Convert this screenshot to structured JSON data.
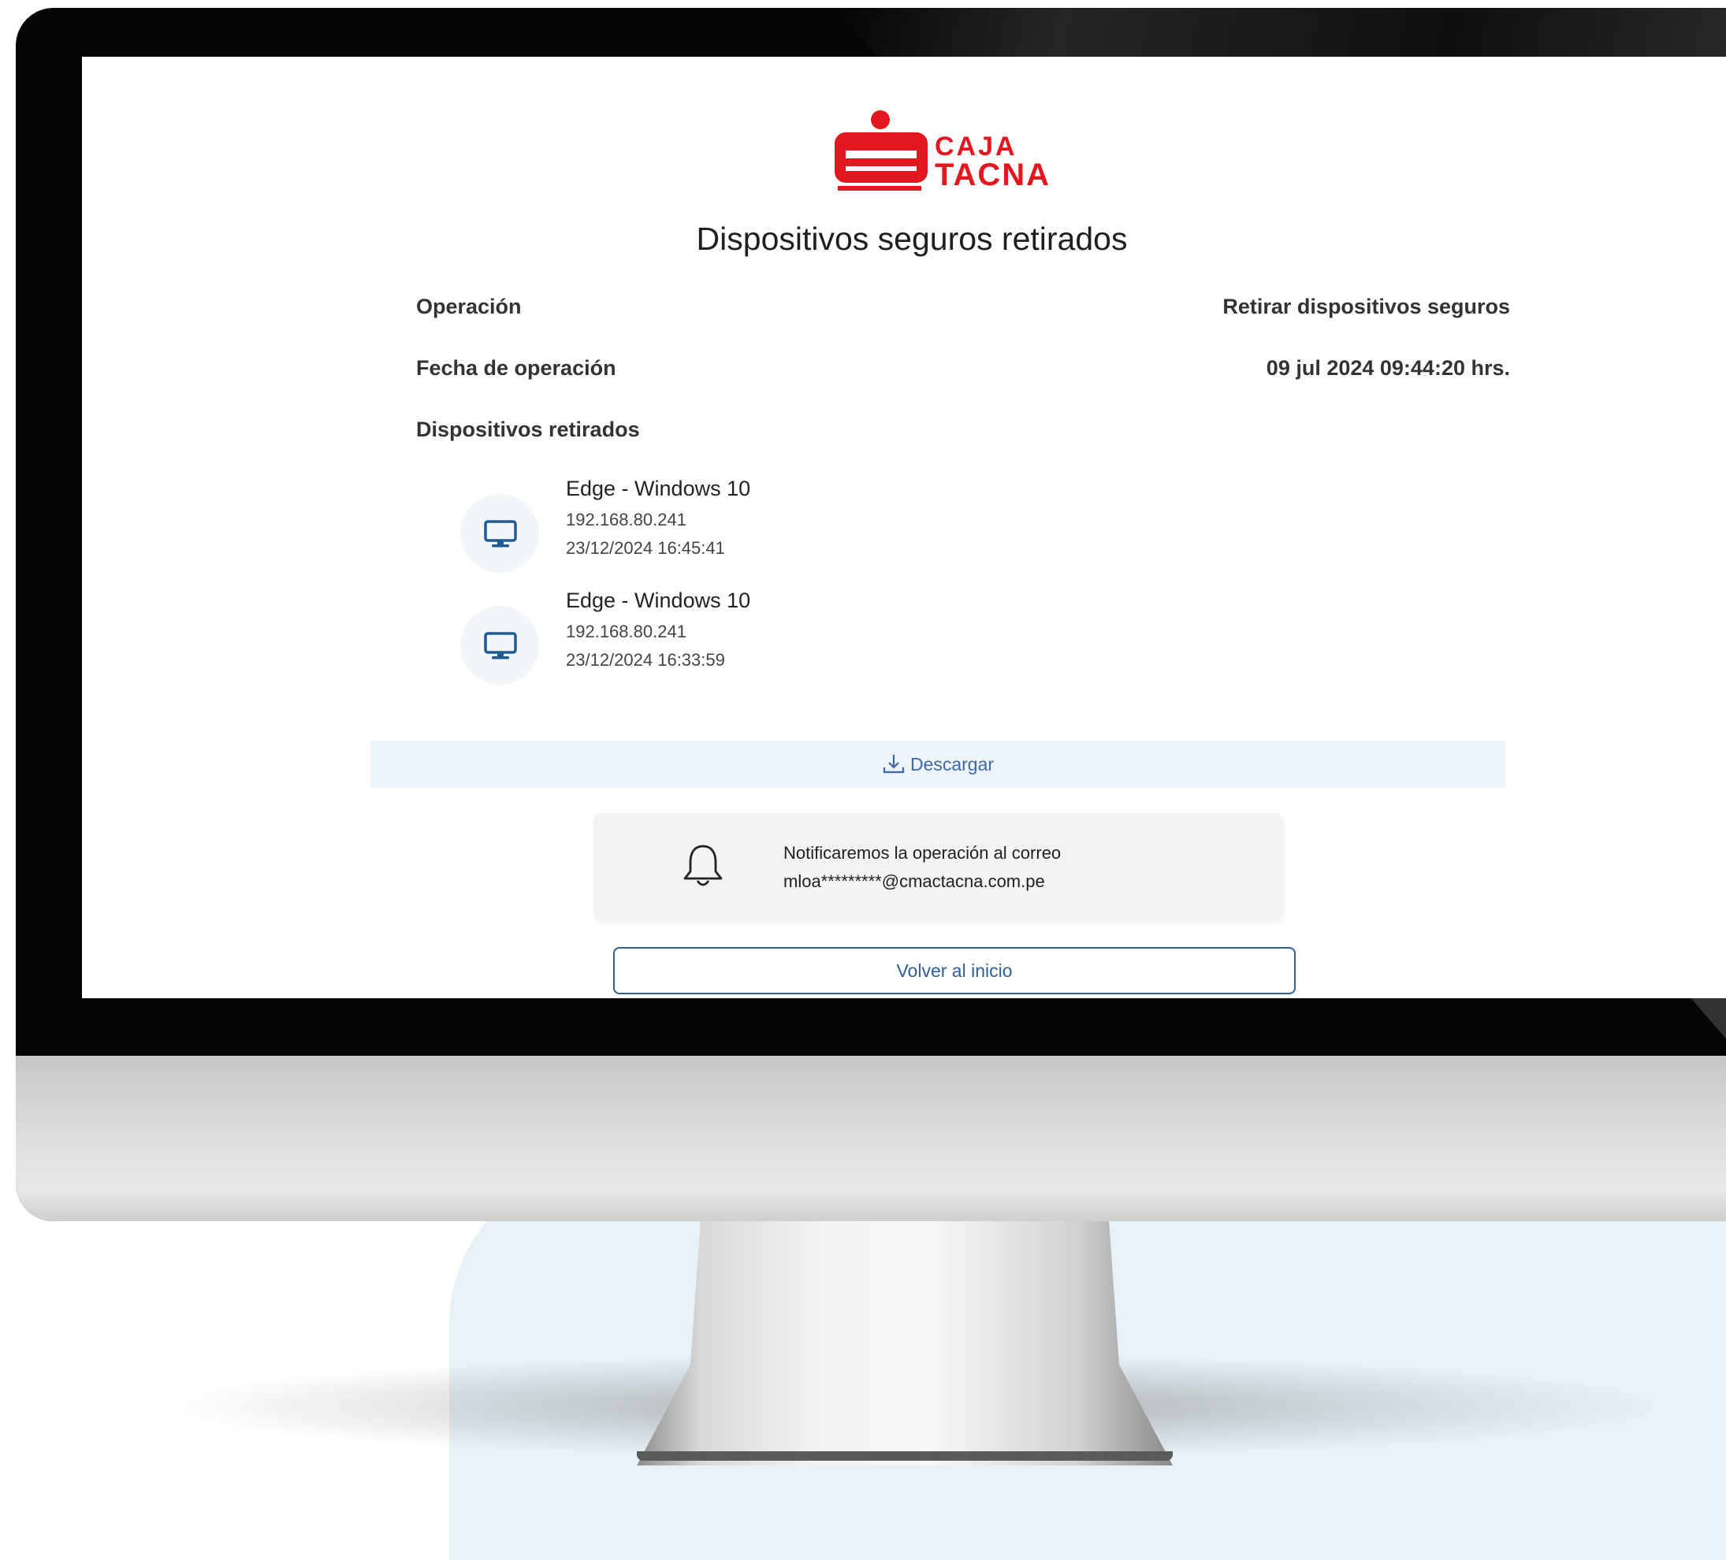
{
  "brand": {
    "name_line1": "CAJA",
    "name_line2": "TACNA",
    "color": "#e3171f"
  },
  "page": {
    "title": "Dispositivos seguros retirados"
  },
  "details": {
    "operation_label": "Operación",
    "operation_value": "Retirar dispositivos seguros",
    "date_label": "Fecha de operación",
    "date_value": "09 jul 2024 09:44:20 hrs.",
    "devices_label": "Dispositivos retirados"
  },
  "devices": [
    {
      "name": "Edge - Windows 10",
      "ip": "192.168.80.241",
      "date": "23/12/2024 16:45:41",
      "icon": "desktop-monitor-icon"
    },
    {
      "name": "Edge - Windows 10",
      "ip": "192.168.80.241",
      "date": "23/12/2024 16:33:59",
      "icon": "desktop-monitor-icon"
    }
  ],
  "actions": {
    "download_label": "Descargar",
    "download_icon": "download-icon",
    "back_label": "Volver al inicio"
  },
  "notice": {
    "icon": "bell-icon",
    "line1": "Notificaremos la operación al correo",
    "line2": "mloa*********@cmactacna.com.pe"
  },
  "colors": {
    "accent": "#2f5f96",
    "download_bg": "#eef4fb",
    "icon_blue": "#1f5b93",
    "brand_red": "#e3171f"
  }
}
